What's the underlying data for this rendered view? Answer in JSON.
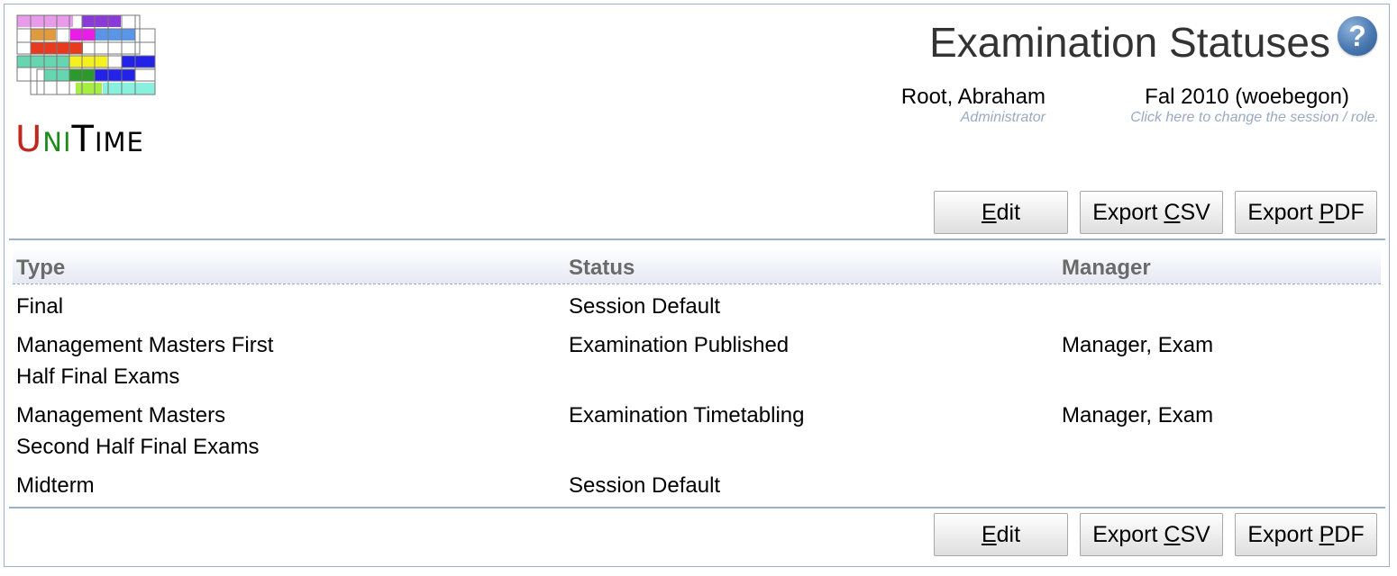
{
  "header": {
    "title": "Examination Statuses",
    "help_icon": "question-mark-icon",
    "logo_text_u": "U",
    "logo_text_ni": "NI",
    "logo_text_t": "T",
    "logo_text_ime": "IME"
  },
  "user": {
    "name": "Root, Abraham",
    "role": "Administrator"
  },
  "session": {
    "name": "Fal 2010 (woebegon)",
    "hint": "Click here to change the session / role."
  },
  "toolbar": {
    "edit_pre": "",
    "edit_key": "E",
    "edit_post": "dit",
    "csv_pre": "Export ",
    "csv_key": "C",
    "csv_post": "SV",
    "pdf_pre": "Export ",
    "pdf_key": "P",
    "pdf_post": "DF"
  },
  "table": {
    "columns": [
      "Type",
      "Status",
      "Manager"
    ],
    "rows": [
      {
        "type_1": "Final",
        "type_2": "",
        "status": "Session Default",
        "manager": ""
      },
      {
        "type_1": "Management Masters First",
        "type_2": "Half Final Exams",
        "status": "Examination Published",
        "manager": "Manager, Exam"
      },
      {
        "type_1": "Management Masters",
        "type_2": "Second Half Final Exams",
        "status": "Examination Timetabling",
        "manager": "Manager, Exam"
      },
      {
        "type_1": "Midterm",
        "type_2": "",
        "status": "Session Default",
        "manager": ""
      }
    ]
  },
  "colors": {
    "border": "#9cb0ce",
    "header_text": "#6a6a6a",
    "hint_text": "#9aa9c4"
  }
}
